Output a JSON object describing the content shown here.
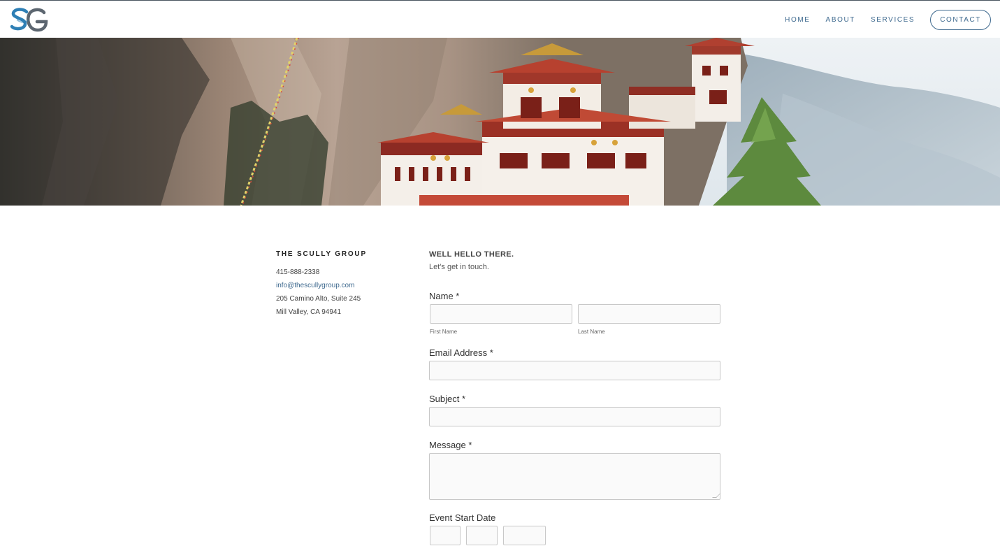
{
  "header": {
    "logo_alt": "SG",
    "nav": [
      {
        "label": "HOME"
      },
      {
        "label": "ABOUT"
      },
      {
        "label": "SERVICES"
      },
      {
        "label": "CONTACT"
      }
    ]
  },
  "info": {
    "company": "THE SCULLY GROUP",
    "phone": "415-888-2338",
    "email": "info@thescullygroup.com",
    "address_line1": "205 Camino Alto, Suite 245",
    "address_line2": "Mill Valley, CA 94941"
  },
  "form": {
    "title": "WELL HELLO THERE.",
    "subtitle": "Let's get in touch.",
    "name_label": "Name *",
    "first_name_sublabel": "First Name",
    "last_name_sublabel": "Last Name",
    "first_name_value": "",
    "last_name_value": "",
    "email_label": "Email Address *",
    "email_value": "",
    "subject_label": "Subject *",
    "subject_value": "",
    "message_label": "Message *",
    "message_value": "",
    "event_date_label": "Event Start Date"
  },
  "colors": {
    "accent": "#3f6a8f",
    "logo_blue": "#2e7fb5",
    "logo_gray": "#5c6670"
  }
}
